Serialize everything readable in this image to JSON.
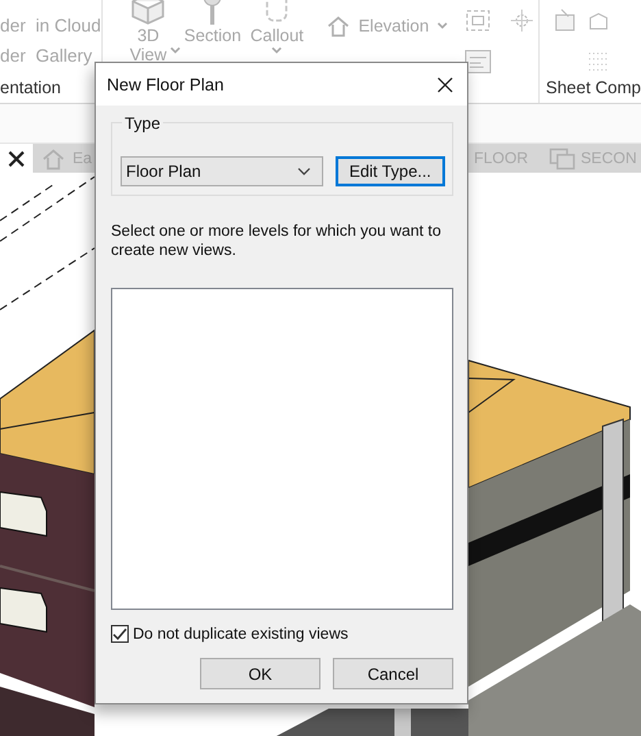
{
  "ribbon": {
    "groups": [
      {
        "kind": "small",
        "items": [
          "der  in Cloud",
          "der  Gallery"
        ],
        "label": "entation"
      },
      {
        "kind": "large",
        "items": [
          {
            "lines": [
              "3D",
              "View"
            ],
            "dropdown": true
          },
          {
            "lines": [
              "Section"
            ],
            "dropdown": false
          },
          {
            "lines": [
              "Callout"
            ],
            "dropdown": true
          }
        ],
        "side": "Elevation"
      },
      {
        "kind": "small",
        "label": "Sheet Comp"
      }
    ]
  },
  "view_tabs": [
    {
      "selected": true,
      "closable": true
    },
    {
      "selected": false,
      "label": "Ea"
    },
    {
      "selected": false,
      "label": "FLOOR"
    },
    {
      "selected": false,
      "label": "SECON"
    }
  ],
  "dialog": {
    "title": "New Floor Plan",
    "type_group": {
      "label": "Type",
      "dropdown": {
        "value": "Floor Plan"
      },
      "button": {
        "label": "Edit Type...",
        "focused": true
      }
    },
    "instructions": "Select one or more levels for which you want to create new views.",
    "checkbox": {
      "label": "Do not duplicate existing views",
      "checked": true
    },
    "buttons": [
      {
        "label": "OK"
      },
      {
        "label": "Cancel"
      }
    ]
  }
}
